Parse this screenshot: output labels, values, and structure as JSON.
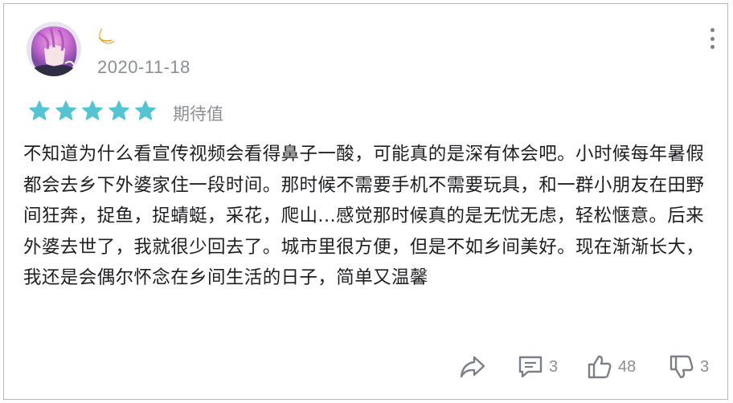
{
  "user": {
    "badge_icon": "crescent-moon-icon",
    "date": "2020-11-18"
  },
  "rating": {
    "stars": 5,
    "max_stars": 5,
    "label": "期待值",
    "star_color": "#55c4d2"
  },
  "review": {
    "text": "不知道为什么看宣传视频会看得鼻子一酸，可能真的是深有体会吧。小时候每年暑假都会去乡下外婆家住一段时间。那时候不需要手机不需要玩具，和一群小朋友在田野间狂奔，捉鱼，捉蜻蜓，采花，爬山...感觉那时候真的是无忧无虑，轻松惬意。后来外婆去世了，我就很少回去了。城市里很方便，但是不如乡间美好。现在渐渐长大，我还是会偶尔怀念在乡间生活的日子，简单又温馨"
  },
  "actions": {
    "share_icon": "share-icon",
    "comment_count": "3",
    "like_count": "48",
    "dislike_count": "3"
  },
  "colors": {
    "text": "#1d1f23",
    "muted": "#8a8f96",
    "accent": "#55c4d2"
  }
}
